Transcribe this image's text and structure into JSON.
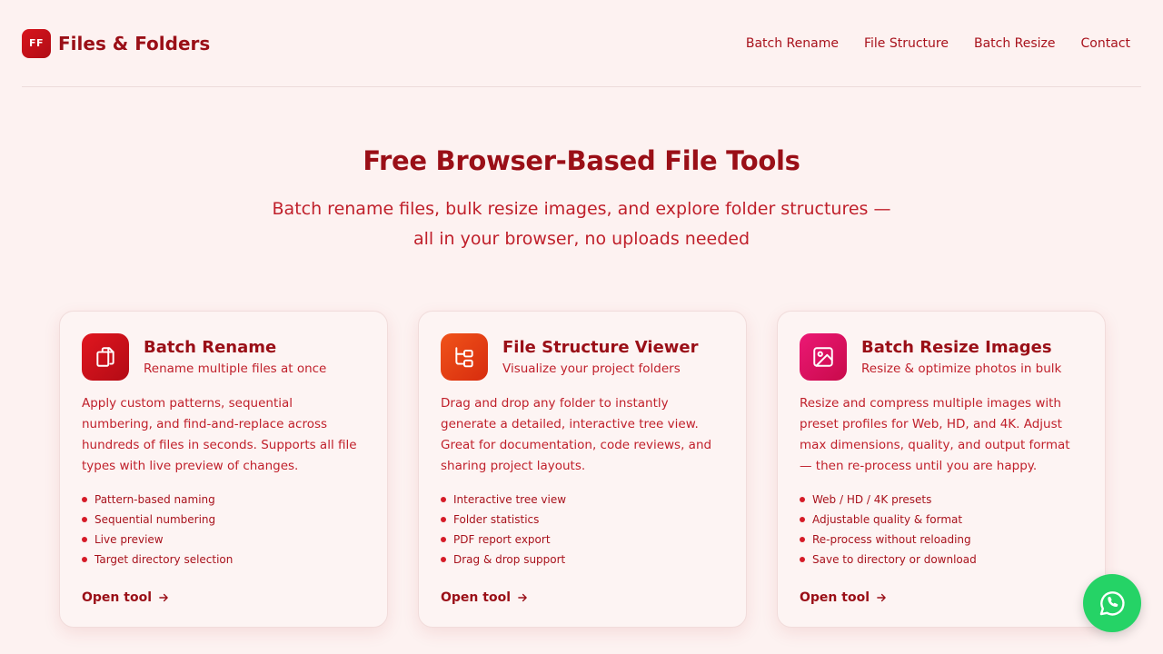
{
  "brand": {
    "logo_text": "FF",
    "name": "Files & Folders"
  },
  "nav": {
    "batch_rename": "Batch Rename",
    "file_structure": "File Structure",
    "batch_resize": "Batch Resize",
    "contact": "Contact"
  },
  "hero": {
    "title": "Free Browser-Based File Tools",
    "subtitle": "Batch rename files, bulk resize images, and explore folder structures — all in your browser, no uploads needed"
  },
  "cards": [
    {
      "title": "Batch Rename",
      "subtitle": "Rename multiple files at once",
      "description": "Apply custom patterns, sequential numbering, and find-and-replace across hundreds of files in seconds. Supports all file types with live preview of changes.",
      "features": [
        "Pattern-based naming",
        "Sequential numbering",
        "Live preview",
        "Target directory selection"
      ],
      "link": "Open tool",
      "icon": "copy-files-icon"
    },
    {
      "title": "File Structure Viewer",
      "subtitle": "Visualize your project folders",
      "description": "Drag and drop any folder to instantly generate a detailed, interactive tree view. Great for documentation, code reviews, and sharing project layouts.",
      "features": [
        "Interactive tree view",
        "Folder statistics",
        "PDF report export",
        "Drag & drop support"
      ],
      "link": "Open tool",
      "icon": "folder-tree-icon"
    },
    {
      "title": "Batch Resize Images",
      "subtitle": "Resize & optimize photos in bulk",
      "description": "Resize and compress multiple images with preset profiles for Web, HD, and 4K. Adjust max dimensions, quality, and output format — then re-process until you are happy.",
      "features": [
        "Web / HD / 4K presets",
        "Adjustable quality & format",
        "Re-process without reloading",
        "Save to directory or download"
      ],
      "link": "Open tool",
      "icon": "image-icon"
    }
  ],
  "colors": {
    "primary": "#9a0f17",
    "accent": "#d51b27",
    "background": "#fdf2f1",
    "whatsapp": "#25d366"
  }
}
